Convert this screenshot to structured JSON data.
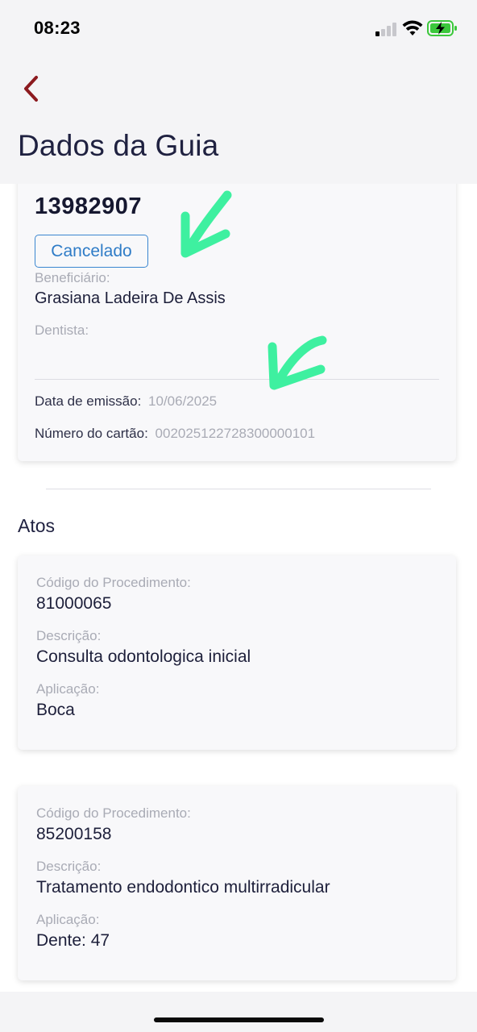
{
  "status_bar": {
    "time": "08:23",
    "icons": [
      "cellular-signal-icon",
      "wifi-icon",
      "battery-charging-icon"
    ],
    "battery_color": "#3cc83c"
  },
  "header": {
    "back_icon": "chevron-left-icon",
    "title": "Dados da Guia",
    "accent_color": "#8c1a1f"
  },
  "guide": {
    "number": "13982907",
    "status": "Cancelado",
    "beneficiary_label": "Beneficiário:",
    "beneficiary_value": "Grasiana Ladeira De Assis",
    "dentist_label": "Dentista:",
    "dentist_value": "",
    "issue_date_label": "Data de emissão:",
    "issue_date_value": "10/06/2025",
    "card_number_label": "Número do cartão:",
    "card_number_value": "00202512272830000010​1"
  },
  "annotations": {
    "arrow_icon": "green-handdrawn-arrow-icon",
    "arrow_color": "#3ef0a0"
  },
  "acts": {
    "section_title": "Atos",
    "items": [
      {
        "code_label": "Código do Procedimento:",
        "code": "81000065",
        "description_label": "Descrição:",
        "description": "Consulta odontologica inicial",
        "application_label": "Aplicação:",
        "application": "Boca"
      },
      {
        "code_label": "Código do Procedimento:",
        "code": "85200158",
        "description_label": "Descrição:",
        "description": "Tratamento endodontico multirradicular",
        "application_label": "Aplicação:",
        "application": "Dente: 47"
      }
    ]
  }
}
